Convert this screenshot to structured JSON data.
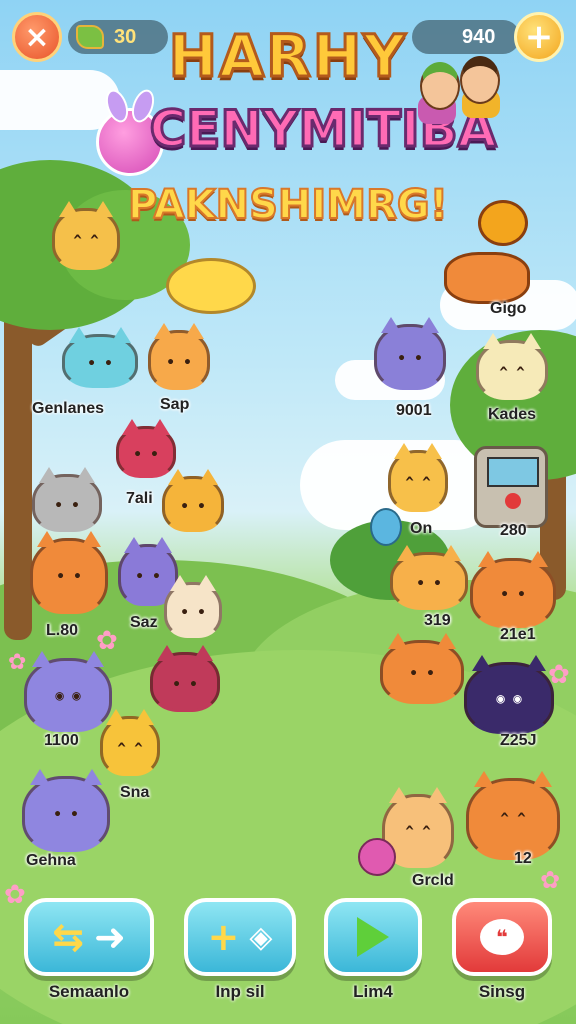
{
  "header": {
    "close_icon": "×",
    "coins": "30",
    "gems": "940",
    "plus_icon": "+"
  },
  "title": {
    "line1": "HARHY",
    "line2": "CENYMITIBA",
    "line3": "PAKNSHIMRG!"
  },
  "pets": [
    {
      "label": "Genlanes"
    },
    {
      "label": "Sap"
    },
    {
      "label": "7ali"
    },
    {
      "label": "L.80"
    },
    {
      "label": "Saz"
    },
    {
      "label": "1100"
    },
    {
      "label": "Sna"
    },
    {
      "label": "Gehna"
    },
    {
      "label": "Gigo"
    },
    {
      "label": "9001"
    },
    {
      "label": "Kades"
    },
    {
      "label": "On"
    },
    {
      "label": "280"
    },
    {
      "label": "319"
    },
    {
      "label": "21e1"
    },
    {
      "label": "Z25J"
    },
    {
      "label": "12"
    },
    {
      "label": "Grcld"
    }
  ],
  "buttons": [
    {
      "label": "Semaanlo",
      "icon": "shuffle-arrow-icon"
    },
    {
      "label": "Inp sil",
      "icon": "plus-tag-icon"
    },
    {
      "label": "Lim4",
      "icon": "play-icon"
    },
    {
      "label": "Sinsg",
      "icon": "chat-bubble-icon"
    }
  ],
  "colors": {
    "sky": "#8fd3f4",
    "grass": "#86c95a",
    "accent_blue": "#3bb7d8",
    "accent_red": "#e23a3a",
    "coin": "#ffe27a"
  }
}
